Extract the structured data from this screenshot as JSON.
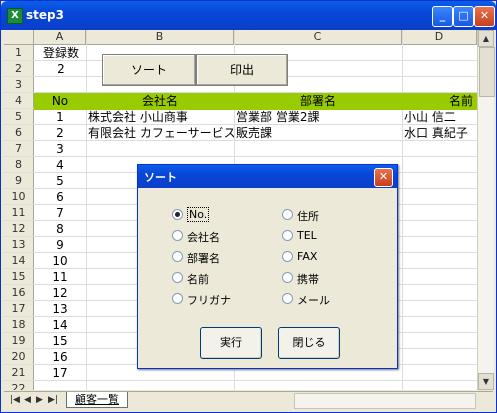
{
  "window": {
    "title": "step3"
  },
  "columns": [
    "A",
    "B",
    "C",
    "D"
  ],
  "rows": [
    "1",
    "2",
    "3",
    "4",
    "5",
    "6",
    "7",
    "8",
    "9",
    "10",
    "11",
    "12",
    "13",
    "14",
    "15",
    "16",
    "17",
    "18",
    "19",
    "20",
    "21",
    "22"
  ],
  "buttons": {
    "sort": "ソート",
    "print": "印出"
  },
  "cells": {
    "a1": "登録数",
    "a2": "2",
    "header": [
      "No",
      "会社名",
      "部署名",
      "名前"
    ],
    "data_rows": [
      [
        "1",
        "株式会社 小山商事",
        "営業部 営業2課",
        "小山 信二"
      ],
      [
        "2",
        "有限会社 カフェーサービス",
        "販売課",
        "水口 真紀子"
      ]
    ],
    "numbers": [
      "3",
      "4",
      "5",
      "6",
      "7",
      "8",
      "9",
      "10",
      "11",
      "12",
      "13",
      "14",
      "15",
      "16",
      "17"
    ]
  },
  "sheet_tab": "顧客一覧",
  "dialog": {
    "title": "ソート",
    "options_left": [
      "No.",
      "会社名",
      "部署名",
      "名前",
      "フリガナ"
    ],
    "options_right": [
      "住所",
      "TEL",
      "FAX",
      "携帯",
      "メール"
    ],
    "selected": "No.",
    "execute": "実行",
    "close": "閉じる"
  }
}
